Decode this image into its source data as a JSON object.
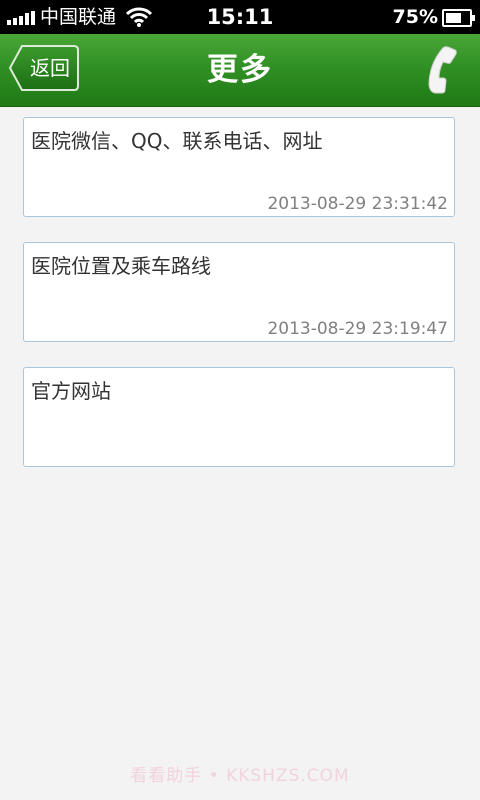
{
  "status_bar": {
    "carrier": "中国联通",
    "time": "15:11",
    "battery_percent": "75%",
    "battery_level": 0.75,
    "signal_icon": "signal-bars-icon",
    "wifi_icon": "wifi-icon"
  },
  "nav": {
    "back_label": "返回",
    "title": "更多",
    "phone_icon": "phone-icon"
  },
  "items": [
    {
      "title": "医院微信、QQ、联系电话、网址",
      "timestamp": "2013-08-29 23:31:42"
    },
    {
      "title": "医院位置及乘车路线",
      "timestamp": "2013-08-29 23:19:47"
    },
    {
      "title": "官方网站",
      "timestamp": ""
    }
  ],
  "watermark": "看看助手 • KKSHZS.COM",
  "colors": {
    "nav_green": "#2f8e23",
    "background": "#f3f3f3",
    "card_border": "#a9c7dc"
  }
}
